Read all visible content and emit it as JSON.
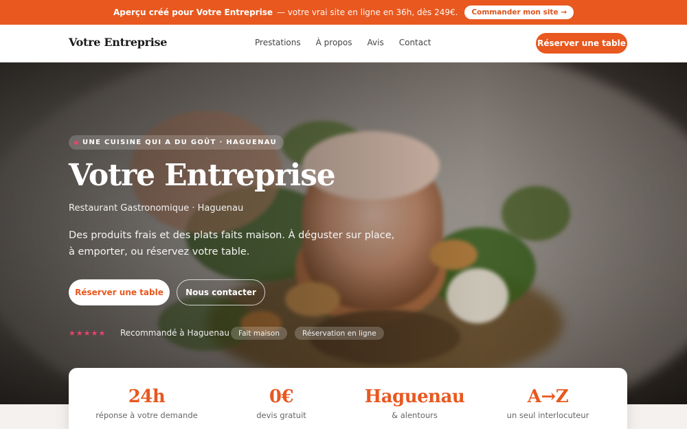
{
  "promo": {
    "lead": "Aperçu créé pour Votre Entreprise",
    "rest": "— votre vrai site en ligne en 36h, dès 249€.",
    "button": "Commander mon site →"
  },
  "header": {
    "brand": "Votre Entreprise",
    "nav": [
      "Prestations",
      "À propos",
      "Avis",
      "Contact"
    ],
    "cta": "Réserver une table"
  },
  "hero": {
    "tag": "UNE CUISINE QUI A DU GOÛT · HAGUENAU",
    "title": "Votre Entreprise",
    "subtitle": "Restaurant Gastronomique · Haguenau",
    "description": "Des produits frais et des plats faits maison. À déguster sur place, à emporter, ou réservez votre table.",
    "primary_button": "Réserver une table",
    "secondary_button": "Nous contacter",
    "stars": "★★★★★",
    "rating": 5,
    "recommendation": "Recommandé à Haguenau",
    "chips": [
      "Fait maison",
      "Réservation en ligne"
    ]
  },
  "stats": [
    {
      "value": "24h",
      "label": "réponse à votre demande"
    },
    {
      "value": "0€",
      "label": "devis gratuit"
    },
    {
      "value": "Haguenau",
      "label": "& alentours"
    },
    {
      "value": "A→Z",
      "label": "un seul interlocuteur"
    }
  ],
  "colors": {
    "accent": "#e8581f",
    "star": "#e8436a"
  }
}
